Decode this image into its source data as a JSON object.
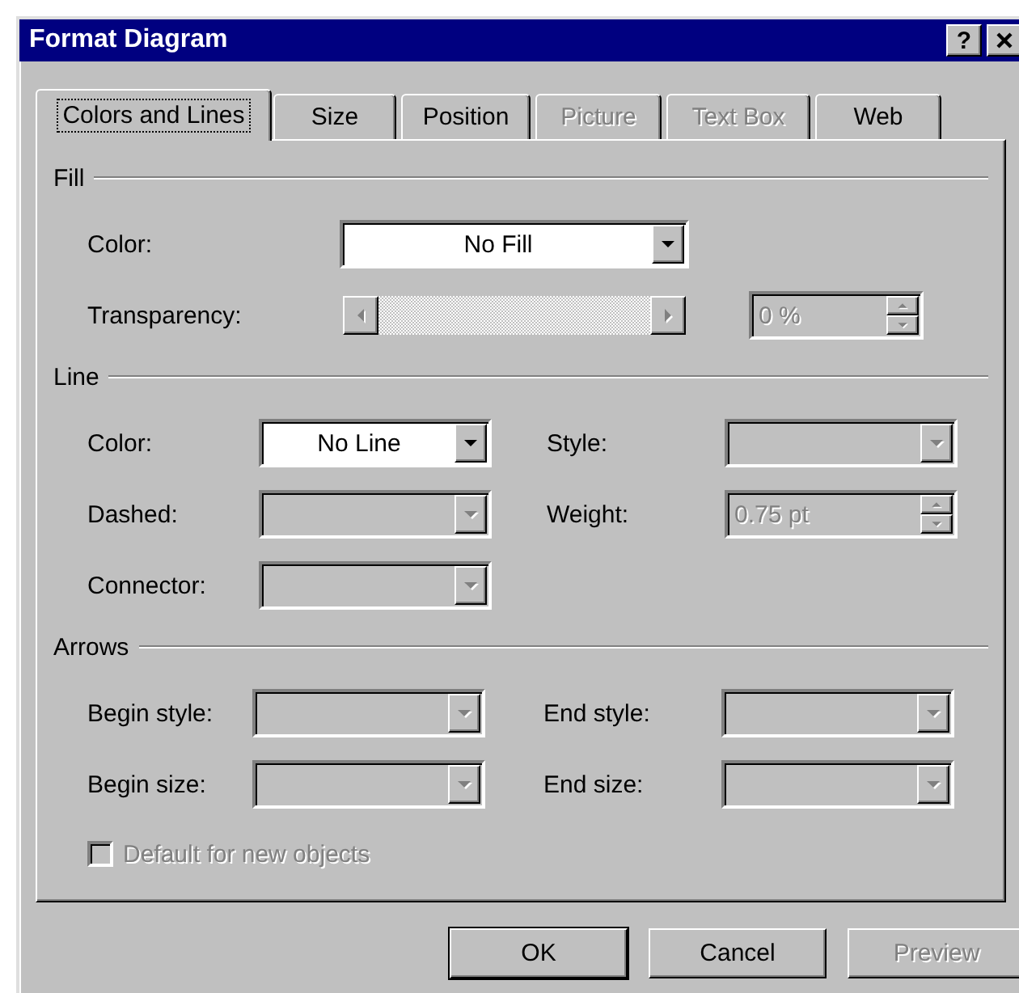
{
  "window": {
    "title": "Format Diagram",
    "help_button": "?"
  },
  "tabs": [
    {
      "label": "Colors and Lines",
      "selected": true,
      "disabled": false
    },
    {
      "label": "Size",
      "selected": false,
      "disabled": false
    },
    {
      "label": "Position",
      "selected": false,
      "disabled": false
    },
    {
      "label": "Picture",
      "selected": false,
      "disabled": true
    },
    {
      "label": "Text Box",
      "selected": false,
      "disabled": true
    },
    {
      "label": "Web",
      "selected": false,
      "disabled": false
    }
  ],
  "sections": [
    {
      "heading": "Fill",
      "rows": [
        [
          {
            "label": "Color:",
            "kind": "dropdown",
            "value": "No Fill",
            "disabled": false
          }
        ],
        [
          {
            "label": "Transparency:",
            "kind": "slider",
            "disabled": true,
            "spin_value": "0 %"
          }
        ]
      ]
    },
    {
      "heading": "Line",
      "rows": [
        [
          {
            "label": "Color:",
            "kind": "dropdown",
            "value": "No Line",
            "disabled": false
          },
          {
            "label": "Style:",
            "kind": "dropdown",
            "disabled": true
          }
        ],
        [
          {
            "label": "Dashed:",
            "kind": "dropdown",
            "disabled": true
          },
          {
            "label": "Weight:",
            "kind": "spin",
            "value": "0.75 pt",
            "disabled": true
          }
        ],
        [
          {
            "label": "Connector:",
            "kind": "dropdown",
            "disabled": true
          }
        ]
      ]
    },
    {
      "heading": "Arrows",
      "rows": [
        [
          {
            "label": "Begin style:",
            "kind": "dropdown",
            "disabled": true
          },
          {
            "label": "End style:",
            "kind": "dropdown",
            "disabled": true
          }
        ],
        [
          {
            "label": "Begin size:",
            "kind": "dropdown",
            "disabled": true
          },
          {
            "label": "End size:",
            "kind": "dropdown",
            "disabled": true
          }
        ]
      ]
    }
  ],
  "default_checkbox": {
    "label": "Default for new objects",
    "checked": false,
    "disabled": true
  },
  "buttons": [
    {
      "label": "OK",
      "disabled": false
    },
    {
      "label": "Cancel",
      "disabled": false
    },
    {
      "label": "Preview",
      "disabled": true
    }
  ]
}
